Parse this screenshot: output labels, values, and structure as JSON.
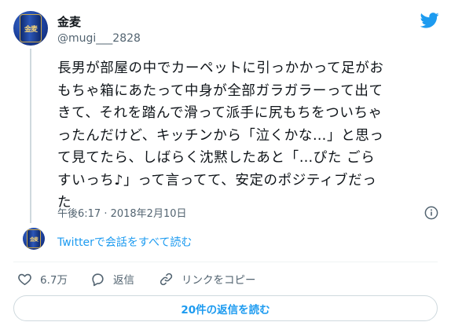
{
  "user": {
    "name": "金麦",
    "handle": "@mugi___2828",
    "avatar_text": "金麦"
  },
  "tweet": {
    "lines": [
      "長男が部屋の中でカーペットに引っかかって足がお",
      "もちゃ箱にあたって中身が全部ガラガラーって出て",
      "きて、それを踏んで滑って派手に尻もちをついちゃ",
      "ったんだけど、キッチンから「泣くかな…」と思っ",
      "て見てたら、しばらく沈黙したあと「…ぴた ごら",
      "すいっち♪」って言ってて、安定のポジティブだっ",
      "た"
    ],
    "timestamp": "午後6:17 · 2018年2月10日"
  },
  "conversation": {
    "read_label": "Twitterで会話をすべて読む"
  },
  "actions": {
    "like_count": "6.7万",
    "reply_label": "返信",
    "copy_link_label": "リンクをコピー"
  },
  "replies_button": {
    "label": "20件の返信を読む"
  },
  "icons": {
    "brand": "twitter-bird-icon",
    "info": "info-icon",
    "like": "heart-icon",
    "reply": "speech-bubble-icon",
    "link": "link-icon"
  },
  "colors": {
    "accent": "#1d9bf0",
    "text": "#0f1419",
    "muted": "#536471",
    "border": "#cfd9de"
  }
}
